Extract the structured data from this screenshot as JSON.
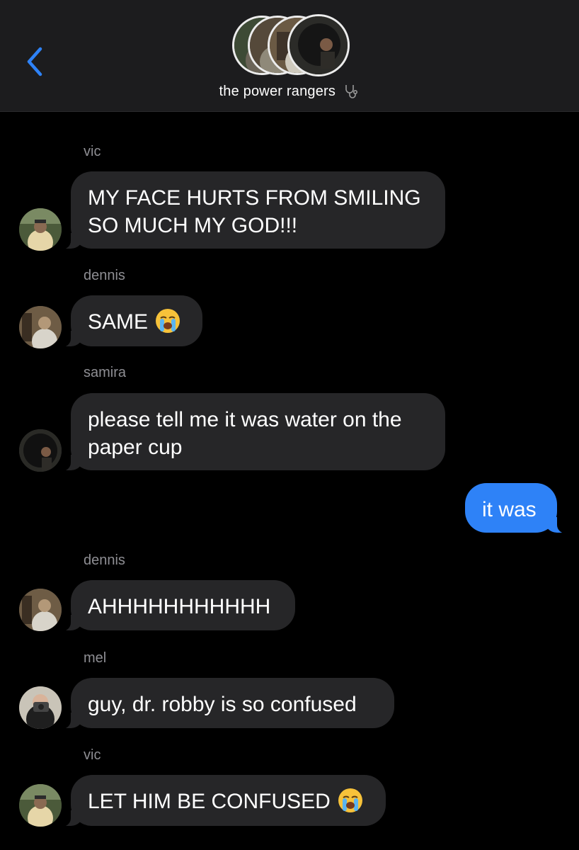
{
  "header": {
    "title": "the power rangers",
    "title_icon": "stethoscope-icon",
    "back_icon": "chevron-left-icon",
    "accent": "#2e82f7",
    "background": "#1c1c1e"
  },
  "messages": [
    {
      "sender": "vic",
      "text": "MY FACE HURTS FROM SMILING\nSO MUCH MY GOD!!!"
    },
    {
      "sender": "dennis",
      "text": "SAME",
      "emoji": "loudly-crying-face-icon"
    },
    {
      "sender": "samira",
      "text": "please tell me it was water on the\npaper cup"
    },
    {
      "sender": "",
      "outgoing": true,
      "text": "it was"
    },
    {
      "sender": "dennis",
      "text": "AHHHHHHHHHHH"
    },
    {
      "sender": "mel",
      "text": "guy, dr. robby is so confused"
    },
    {
      "sender": "vic",
      "text": "LET HIM BE CONFUSED",
      "emoji": "loudly-crying-face-icon"
    }
  ],
  "colors": {
    "incoming_bubble": "#262628",
    "outgoing_bubble": "#2e82f7",
    "sender_name": "#8e8e93"
  }
}
